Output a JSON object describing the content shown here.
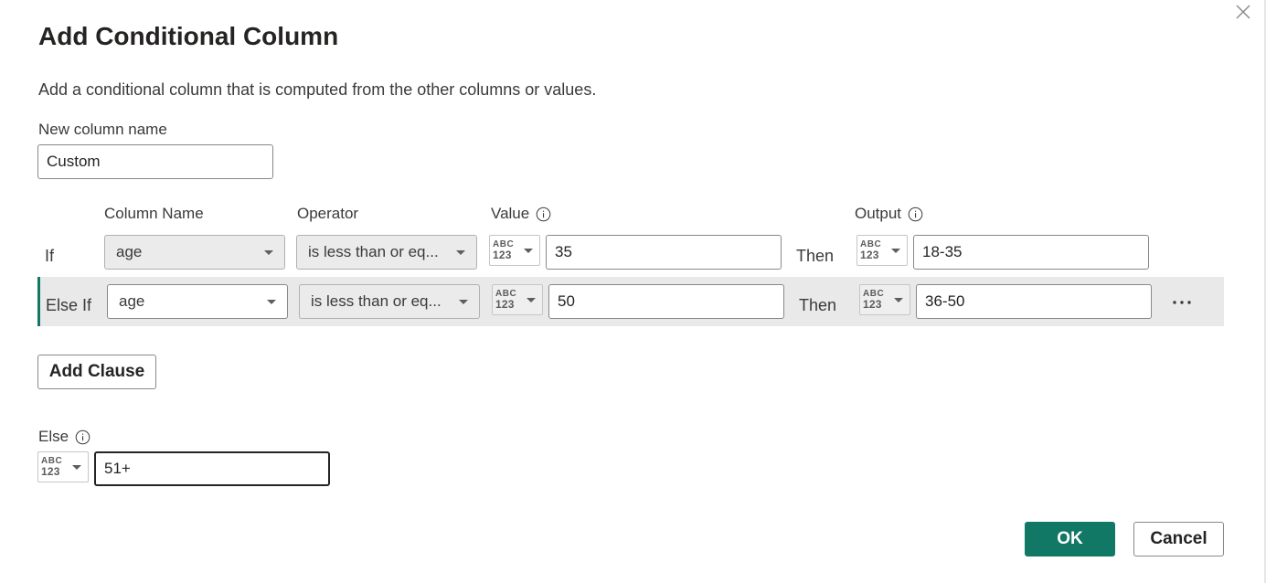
{
  "dialog": {
    "title": "Add Conditional Column",
    "description": "Add a conditional column that is computed from the other columns or values."
  },
  "new_column": {
    "label": "New column name",
    "value": "Custom"
  },
  "headers": {
    "column_name": "Column Name",
    "operator": "Operator",
    "value": "Value",
    "output": "Output"
  },
  "type_icon": {
    "line1": "ABC",
    "line2": "123"
  },
  "clauses": [
    {
      "label": "If",
      "column": "age",
      "operator": "is less than or eq...",
      "value": "35",
      "then_label": "Then",
      "output": "18-35"
    },
    {
      "label": "Else If",
      "column": "age",
      "operator": "is less than or eq...",
      "value": "50",
      "then_label": "Then",
      "output": "36-50"
    }
  ],
  "add_clause_label": "Add Clause",
  "else": {
    "label": "Else",
    "value": "51+"
  },
  "buttons": {
    "ok": "OK",
    "cancel": "Cancel"
  },
  "colors": {
    "accent": "#117865",
    "row_highlight": "#e9e9e9",
    "select_bg": "#ebebeb"
  },
  "icons": {
    "close": "close-icon",
    "info": "info-icon",
    "more": "more-options-icon",
    "type": "any-type-icon",
    "dropdown": "chevron-down-icon"
  }
}
